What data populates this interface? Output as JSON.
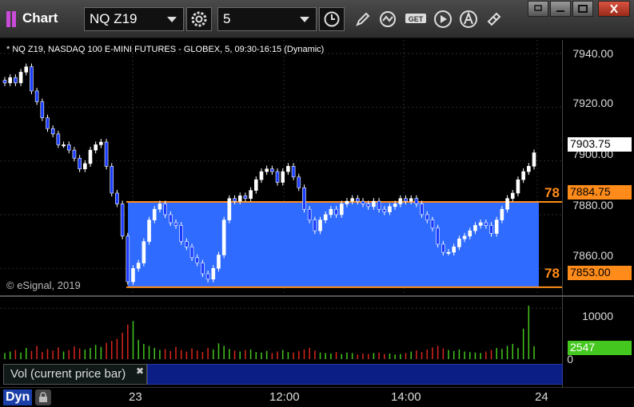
{
  "app": {
    "title": "Chart"
  },
  "toolbar": {
    "symbol": "NQ Z19",
    "interval": "5",
    "buttons": [
      "settings-icon",
      "clock-icon",
      "pencil-icon",
      "study-icon",
      "get-icon",
      "play-icon",
      "alert-icon",
      "link-icon"
    ]
  },
  "chart": {
    "symbol_description": "* NQ Z19, NASDAQ 100 E-MINI FUTURES - GLOBEX, 5, 09:30-16:15 (Dynamic)",
    "copyright": "© eSignal, 2019",
    "y_ticks": [
      "7940.00",
      "7920.00",
      "7900.00",
      "7880.00",
      "7860.00"
    ],
    "last_price": "7903.75",
    "upper_level": {
      "label": "78",
      "price": "7884.75"
    },
    "lower_level": {
      "label": "78",
      "price": "7853.00"
    },
    "x_ticks": [
      "23",
      "12:00",
      "14:00",
      "24"
    ],
    "range_box_color": "#2f6bff",
    "level_color": "#ff8c1a"
  },
  "volume": {
    "study_label": "Vol (current price bar)",
    "y_ticks": [
      "10000",
      "0"
    ],
    "current": "2547"
  },
  "footer": {
    "mode": "Dyn"
  },
  "chart_data": {
    "type": "candlestick",
    "ylim": [
      7850,
      7945
    ],
    "bars_close": [
      7929,
      7931,
      7929,
      7933,
      7935,
      7926,
      7922,
      7916,
      7912,
      7910,
      7906,
      7906,
      7904,
      7901,
      7897,
      7899,
      7904,
      7906,
      7907,
      7898,
      7888,
      7884,
      7872,
      7855,
      7860,
      7862,
      7870,
      7878,
      7882,
      7884,
      7880,
      7877,
      7876,
      7870,
      7868,
      7864,
      7862,
      7858,
      7856,
      7860,
      7865,
      7878,
      7886,
      7885,
      7887,
      7886,
      7889,
      7893,
      7896,
      7897,
      7896,
      7892,
      7896,
      7898,
      7894,
      7890,
      7882,
      7878,
      7874,
      7878,
      7880,
      7882,
      7880,
      7884,
      7885,
      7886,
      7885,
      7884,
      7883,
      7885,
      7882,
      7881,
      7883,
      7884,
      7886,
      7885,
      7886,
      7884,
      7880,
      7878,
      7875,
      7869,
      7866,
      7866,
      7868,
      7871,
      7872,
      7874,
      7876,
      7877,
      7876,
      7873,
      7878,
      7882,
      7886,
      7888,
      7893,
      7896,
      7898,
      7903
    ],
    "volume_values": [
      1200,
      1500,
      1800,
      1300,
      2200,
      1600,
      2600,
      1400,
      2000,
      1700,
      2300,
      1500,
      1800,
      2500,
      2100,
      1900,
      2200,
      2800,
      2400,
      3200,
      3600,
      4000,
      5200,
      6800,
      7500,
      3800,
      3000,
      2600,
      2200,
      1800,
      2000,
      1600,
      2400,
      1800,
      1500,
      2100,
      1700,
      1400,
      2200,
      1900,
      3100,
      2600,
      2000,
      1700,
      1500,
      1800,
      1900,
      1400,
      1300,
      1600,
      1200,
      1500,
      1800,
      1400,
      1300,
      1600,
      1900,
      2200,
      1700,
      1300,
      1200,
      1100,
      1400,
      1000,
      1300,
      1200,
      900,
      1100,
      1000,
      1200,
      1300,
      1000,
      1100,
      900,
      1000,
      1200,
      1500,
      1700,
      1400,
      1900,
      2300,
      2600,
      2100,
      1800,
      1600,
      1900,
      1500,
      1400,
      1300,
      1200,
      1500,
      1800,
      2200,
      2000,
      2600,
      3000,
      2200,
      6000,
      10500,
      2547
    ]
  }
}
